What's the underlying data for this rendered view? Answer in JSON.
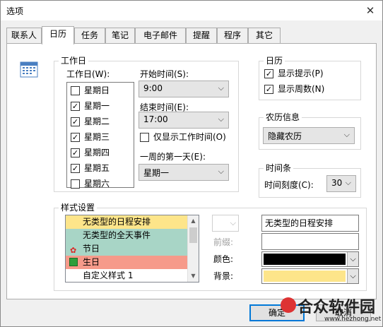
{
  "window": {
    "title": "选项"
  },
  "tabs": [
    "联系人",
    "日历",
    "任务",
    "笔记",
    "电子邮件",
    "提醒",
    "程序",
    "其它"
  ],
  "workday": {
    "group_label": "工作日",
    "days_label": "工作日(W):",
    "days": [
      {
        "label": "星期日",
        "checked": false
      },
      {
        "label": "星期一",
        "checked": true
      },
      {
        "label": "星期二",
        "checked": true
      },
      {
        "label": "星期三",
        "checked": true
      },
      {
        "label": "星期四",
        "checked": true
      },
      {
        "label": "星期五",
        "checked": true
      },
      {
        "label": "星期六",
        "checked": false
      }
    ],
    "start_label": "开始时间(S):",
    "start_value": "9:00",
    "end_label": "结束时间(E):",
    "end_value": "17:00",
    "only_show_worktime_label": "仅显示工作时间(O)",
    "only_show_worktime_checked": false,
    "first_day_label": "一周的第一天(E):",
    "first_day_value": "星期一"
  },
  "calendar": {
    "group_label": "日历",
    "show_tips_label": "显示提示(P)",
    "show_tips_checked": true,
    "show_weeks_label": "显示周数(N)",
    "show_weeks_checked": true
  },
  "lunar": {
    "group_label": "农历信息",
    "value": "隐藏农历"
  },
  "timebar": {
    "group_label": "时间条",
    "scale_label": "时间刻度(C):",
    "scale_value": "30"
  },
  "styles": {
    "group_label": "样式设置",
    "items": [
      {
        "label": "无类型的日程安排",
        "bg": "#fde58a",
        "icon": ""
      },
      {
        "label": "无类型的全天事件",
        "bg": "#a8d5c6",
        "icon": ""
      },
      {
        "label": "节日",
        "bg": "#a8d5c6",
        "icon": "balloon-icon"
      },
      {
        "label": "生日",
        "bg": "#f69a8a",
        "icon": "gift-icon"
      },
      {
        "label": "自定义样式 1",
        "bg": "#ffffff",
        "icon": ""
      }
    ],
    "name_value": "无类型的日程安排",
    "prefix_label": "前缀:",
    "prefix_value": "",
    "color_label": "颜色:",
    "color_value": "#000000",
    "background_label": "背景:",
    "background_value": "#fde58a"
  },
  "buttons": {
    "ok": "确定",
    "cancel": "取消"
  },
  "watermark": {
    "text": "合众软件园",
    "url": "www.hezhong.net"
  }
}
